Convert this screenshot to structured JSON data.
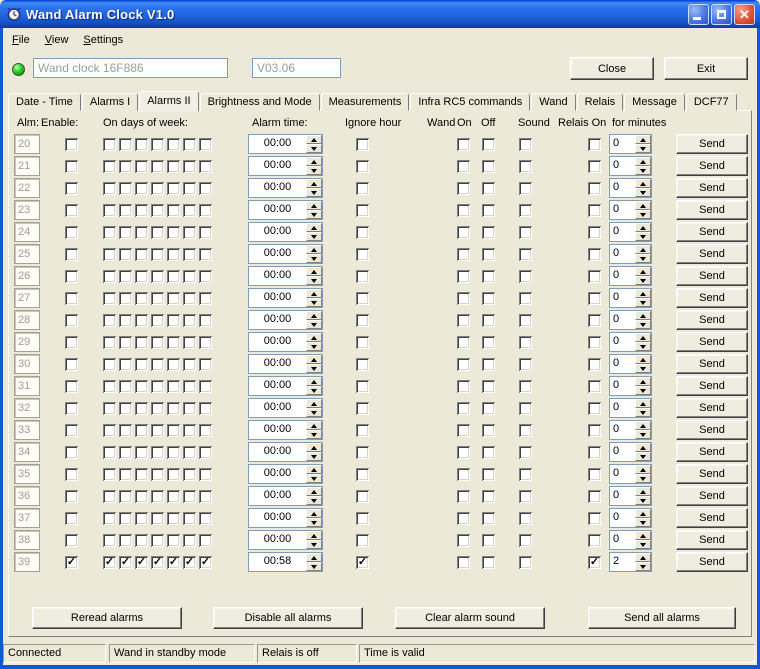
{
  "window": {
    "title": "Wand Alarm Clock V1.0"
  },
  "menu": {
    "items": [
      "File",
      "View",
      "Settings"
    ]
  },
  "toolbar": {
    "led_status": "green",
    "device_field_value": "Wand clock 16F886",
    "version_field_value": "V03.06",
    "close_label": "Close",
    "exit_label": "Exit"
  },
  "tabs": {
    "labels": [
      "Date - Time",
      "Alarms I",
      "Alarms II",
      "Brightness and Mode",
      "Measurements",
      "Infra RC5 commands",
      "Wand",
      "Relais",
      "Message",
      "DCF77"
    ],
    "active": "Alarms II",
    "active_index": 2
  },
  "table": {
    "columns": {
      "alm": "Alm:",
      "enable": "Enable:",
      "days": "On days of week:",
      "time": "Alarm time:",
      "ignore": "Ignore hour",
      "wand": "Wand",
      "on": "On",
      "off": "Off",
      "sound": "Sound",
      "relais": "Relais On",
      "minutes": "for minutes"
    },
    "send_label": "Send",
    "rows": [
      {
        "num": "20",
        "enable": false,
        "days": [
          false,
          false,
          false,
          false,
          false,
          false,
          false
        ],
        "time": "00:00",
        "ignore": false,
        "on": false,
        "off": false,
        "sound": false,
        "relais": false,
        "minutes": "0"
      },
      {
        "num": "21",
        "enable": false,
        "days": [
          false,
          false,
          false,
          false,
          false,
          false,
          false
        ],
        "time": "00:00",
        "ignore": false,
        "on": false,
        "off": false,
        "sound": false,
        "relais": false,
        "minutes": "0"
      },
      {
        "num": "22",
        "enable": false,
        "days": [
          false,
          false,
          false,
          false,
          false,
          false,
          false
        ],
        "time": "00:00",
        "ignore": false,
        "on": false,
        "off": false,
        "sound": false,
        "relais": false,
        "minutes": "0"
      },
      {
        "num": "23",
        "enable": false,
        "days": [
          false,
          false,
          false,
          false,
          false,
          false,
          false
        ],
        "time": "00:00",
        "ignore": false,
        "on": false,
        "off": false,
        "sound": false,
        "relais": false,
        "minutes": "0"
      },
      {
        "num": "24",
        "enable": false,
        "days": [
          false,
          false,
          false,
          false,
          false,
          false,
          false
        ],
        "time": "00:00",
        "ignore": false,
        "on": false,
        "off": false,
        "sound": false,
        "relais": false,
        "minutes": "0"
      },
      {
        "num": "25",
        "enable": false,
        "days": [
          false,
          false,
          false,
          false,
          false,
          false,
          false
        ],
        "time": "00:00",
        "ignore": false,
        "on": false,
        "off": false,
        "sound": false,
        "relais": false,
        "minutes": "0"
      },
      {
        "num": "26",
        "enable": false,
        "days": [
          false,
          false,
          false,
          false,
          false,
          false,
          false
        ],
        "time": "00:00",
        "ignore": false,
        "on": false,
        "off": false,
        "sound": false,
        "relais": false,
        "minutes": "0"
      },
      {
        "num": "27",
        "enable": false,
        "days": [
          false,
          false,
          false,
          false,
          false,
          false,
          false
        ],
        "time": "00:00",
        "ignore": false,
        "on": false,
        "off": false,
        "sound": false,
        "relais": false,
        "minutes": "0"
      },
      {
        "num": "28",
        "enable": false,
        "days": [
          false,
          false,
          false,
          false,
          false,
          false,
          false
        ],
        "time": "00:00",
        "ignore": false,
        "on": false,
        "off": false,
        "sound": false,
        "relais": false,
        "minutes": "0"
      },
      {
        "num": "29",
        "enable": false,
        "days": [
          false,
          false,
          false,
          false,
          false,
          false,
          false
        ],
        "time": "00:00",
        "ignore": false,
        "on": false,
        "off": false,
        "sound": false,
        "relais": false,
        "minutes": "0"
      },
      {
        "num": "30",
        "enable": false,
        "days": [
          false,
          false,
          false,
          false,
          false,
          false,
          false
        ],
        "time": "00:00",
        "ignore": false,
        "on": false,
        "off": false,
        "sound": false,
        "relais": false,
        "minutes": "0"
      },
      {
        "num": "31",
        "enable": false,
        "days": [
          false,
          false,
          false,
          false,
          false,
          false,
          false
        ],
        "time": "00:00",
        "ignore": false,
        "on": false,
        "off": false,
        "sound": false,
        "relais": false,
        "minutes": "0"
      },
      {
        "num": "32",
        "enable": false,
        "days": [
          false,
          false,
          false,
          false,
          false,
          false,
          false
        ],
        "time": "00:00",
        "ignore": false,
        "on": false,
        "off": false,
        "sound": false,
        "relais": false,
        "minutes": "0"
      },
      {
        "num": "33",
        "enable": false,
        "days": [
          false,
          false,
          false,
          false,
          false,
          false,
          false
        ],
        "time": "00:00",
        "ignore": false,
        "on": false,
        "off": false,
        "sound": false,
        "relais": false,
        "minutes": "0"
      },
      {
        "num": "34",
        "enable": false,
        "days": [
          false,
          false,
          false,
          false,
          false,
          false,
          false
        ],
        "time": "00:00",
        "ignore": false,
        "on": false,
        "off": false,
        "sound": false,
        "relais": false,
        "minutes": "0"
      },
      {
        "num": "35",
        "enable": false,
        "days": [
          false,
          false,
          false,
          false,
          false,
          false,
          false
        ],
        "time": "00:00",
        "ignore": false,
        "on": false,
        "off": false,
        "sound": false,
        "relais": false,
        "minutes": "0"
      },
      {
        "num": "36",
        "enable": false,
        "days": [
          false,
          false,
          false,
          false,
          false,
          false,
          false
        ],
        "time": "00:00",
        "ignore": false,
        "on": false,
        "off": false,
        "sound": false,
        "relais": false,
        "minutes": "0"
      },
      {
        "num": "37",
        "enable": false,
        "days": [
          false,
          false,
          false,
          false,
          false,
          false,
          false
        ],
        "time": "00:00",
        "ignore": false,
        "on": false,
        "off": false,
        "sound": false,
        "relais": false,
        "minutes": "0"
      },
      {
        "num": "38",
        "enable": false,
        "days": [
          false,
          false,
          false,
          false,
          false,
          false,
          false
        ],
        "time": "00:00",
        "ignore": false,
        "on": false,
        "off": false,
        "sound": false,
        "relais": false,
        "minutes": "0"
      },
      {
        "num": "39",
        "enable": true,
        "days": [
          true,
          true,
          true,
          true,
          true,
          true,
          true
        ],
        "time": "00:58",
        "ignore": true,
        "on": false,
        "off": false,
        "sound": false,
        "relais": true,
        "minutes": "2"
      }
    ]
  },
  "footer": {
    "buttons": [
      "Reread alarms",
      "Disable all alarms",
      "Clear alarm sound",
      "Send all alarms"
    ]
  },
  "status": {
    "panels": [
      "Connected",
      "Wand in standby mode",
      "Relais is off",
      "Time is valid"
    ]
  },
  "colors": {
    "titlebar_blue": "#2D74EC",
    "window_border": "#0F58D8",
    "window_face": "#ECE9D8",
    "led_green": "#22C522",
    "close_button_red": "#D6492A"
  }
}
